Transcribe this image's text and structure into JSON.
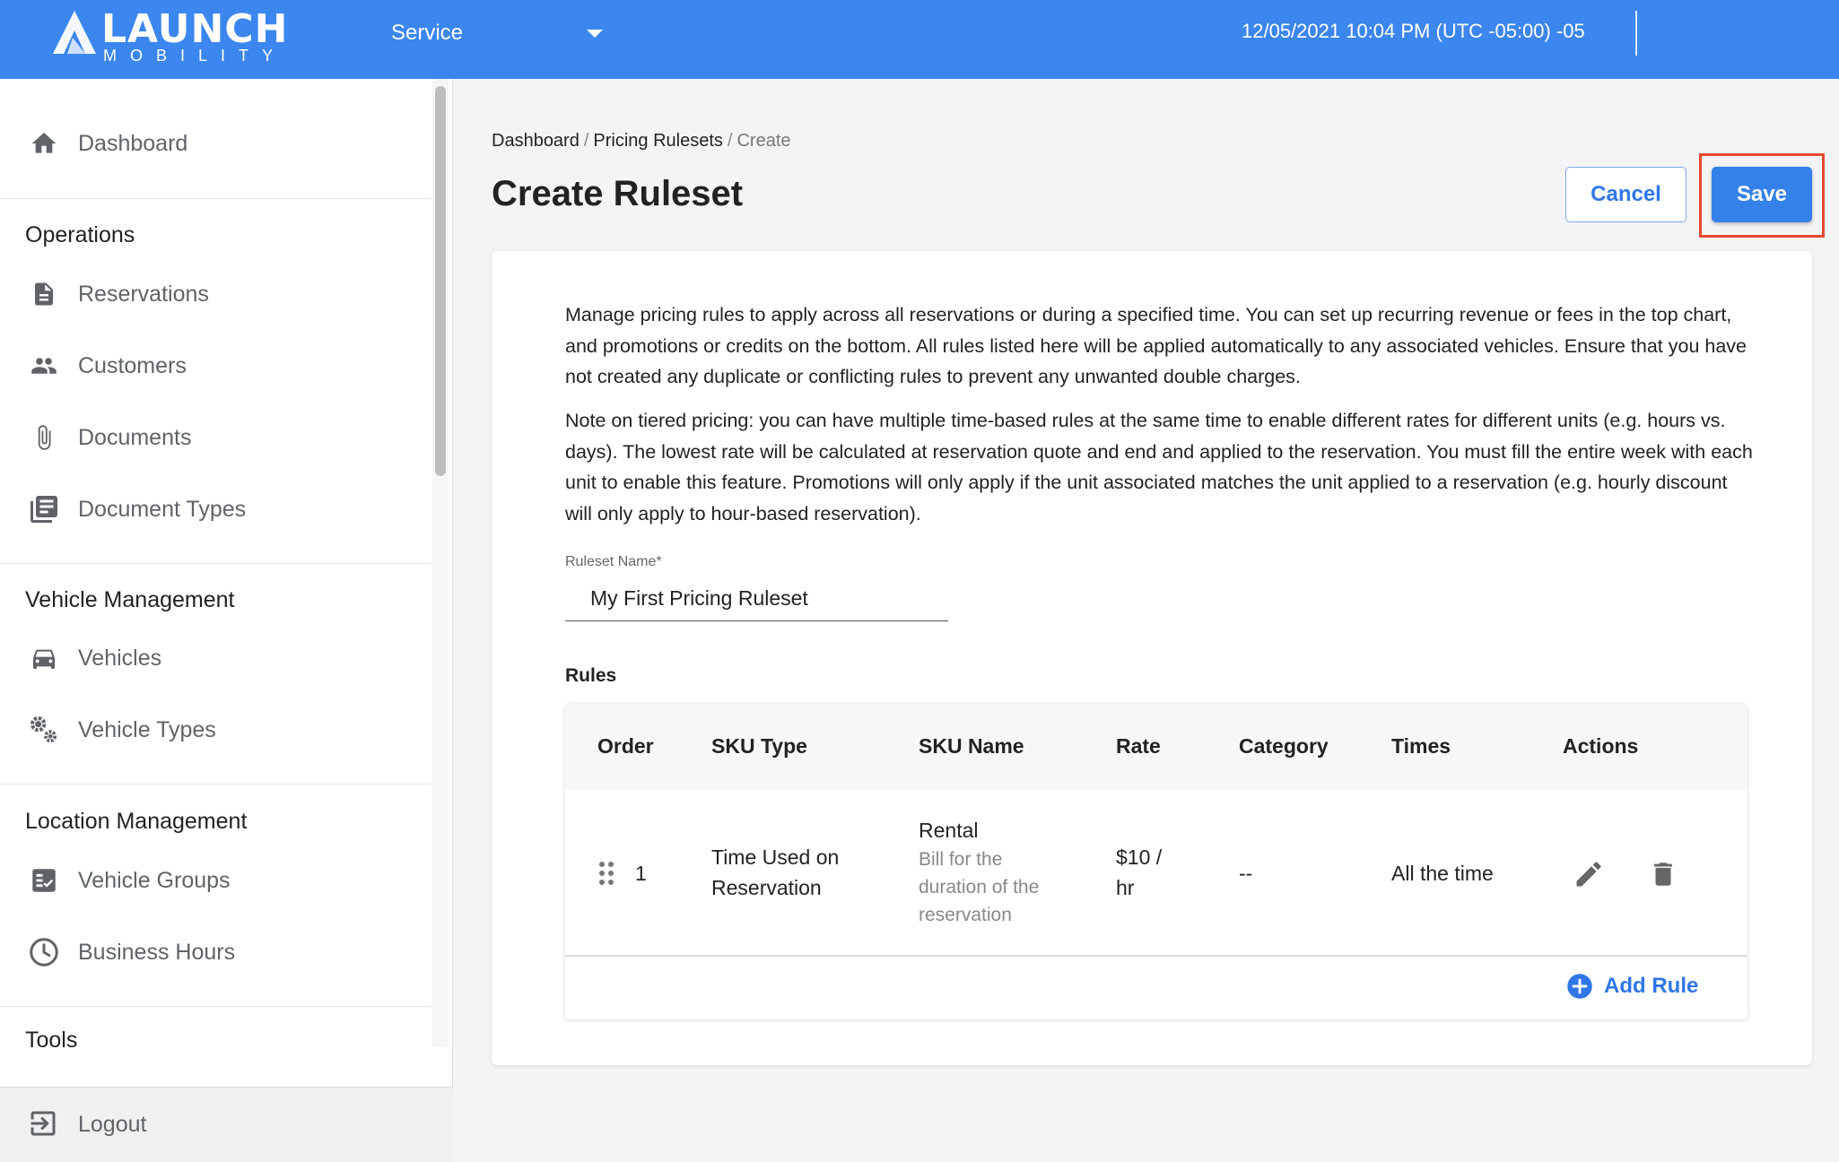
{
  "header": {
    "logo_text": "LAUNCH",
    "logo_sub": "MOBILITY",
    "service_label": "Service",
    "datetime": "12/05/2021 10:04 PM (UTC -05:00) -05"
  },
  "sidebar": {
    "dashboard": "Dashboard",
    "operations_title": "Operations",
    "operations": [
      "Reservations",
      "Customers",
      "Documents",
      "Document Types"
    ],
    "vehicle_mgmt_title": "Vehicle Management",
    "vehicle_mgmt": [
      "Vehicles",
      "Vehicle Types"
    ],
    "location_mgmt_title": "Location Management",
    "location_mgmt": [
      "Vehicle Groups",
      "Business Hours"
    ],
    "tools_title": "Tools",
    "logout": "Logout",
    "icons": {
      "dashboard": "home-icon",
      "reservations": "document-icon",
      "customers": "people-icon",
      "documents": "paperclip-icon",
      "document_types": "library-icon",
      "vehicles": "car-icon",
      "vehicle_types": "gears-icon",
      "vehicle_groups": "checklist-icon",
      "business_hours": "clock-icon",
      "logout": "logout-icon"
    }
  },
  "breadcrumb": {
    "items": [
      "Dashboard",
      "Pricing Rulesets"
    ],
    "current": "Create"
  },
  "page": {
    "title": "Create Ruleset",
    "cancel_label": "Cancel",
    "save_label": "Save"
  },
  "intro": {
    "paragraph1": "Manage pricing rules to apply across all reservations or during a specified time. You can set up recurring revenue or fees in the top chart, and promotions or credits on the bottom. All rules listed here will be applied automatically to any associated vehicles. Ensure that you have not created any duplicate or conflicting rules to prevent any unwanted double charges.",
    "paragraph2": "Note on tiered pricing: you can have multiple time-based rules at the same time to enable different rates for different units (e.g. hours vs. days). The lowest rate will be calculated at reservation quote and end and applied to the reservation. You must fill the entire week with each unit to enable this feature. Promotions will only apply if the unit associated matches the unit applied to a reservation (e.g. hourly discount will only apply to hour-based reservation)."
  },
  "form": {
    "ruleset_name_label": "Ruleset Name*",
    "ruleset_name_value": "My First Pricing Ruleset"
  },
  "rules": {
    "heading": "Rules",
    "columns": [
      "Order",
      "SKU Type",
      "SKU Name",
      "Rate",
      "Category",
      "Times",
      "Actions"
    ],
    "rows": [
      {
        "order": "1",
        "sku_type_line1": "Time Used on",
        "sku_type_line2": "Reservation",
        "sku_name": "Rental",
        "sku_desc_line1": "Bill for the",
        "sku_desc_line2": "duration of the",
        "sku_desc_line3": "reservation",
        "rate_line1": "$10 /",
        "rate_line2": "hr",
        "category": "--",
        "times": "All the time"
      }
    ],
    "add_rule_label": "Add Rule"
  },
  "colors": {
    "brand": "#3b86ef",
    "primary_button": "#3581ea",
    "highlight": "#e64a2e"
  }
}
